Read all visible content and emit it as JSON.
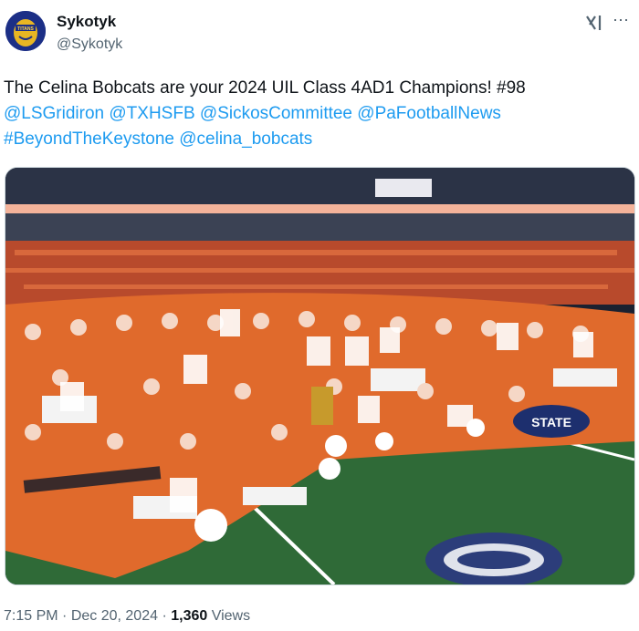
{
  "author": {
    "display_name": "Sykotyk",
    "handle": "@Sykotyk",
    "avatar_text": "TITANS"
  },
  "tweet": {
    "text_plain": "The Celina Bobcats are your 2024 UIL Class 4AD1 Champions! #98",
    "mentions_line1": "@LSGridiron @TXHSFB @SickosCommittee @PaFootballNews",
    "mentions_line2": "#BeyondTheKeystone @celina_bobcats"
  },
  "meta": {
    "time": "7:15 PM",
    "sep1": " · ",
    "date": "Dec 20, 2024",
    "sep2": " · ",
    "views_count": "1,360",
    "views_label": " Views"
  },
  "icons": {
    "grok": "grok-icon",
    "more": "more-options-icon"
  },
  "photo": {
    "alt_sign": "FOOTBALL STATE"
  }
}
